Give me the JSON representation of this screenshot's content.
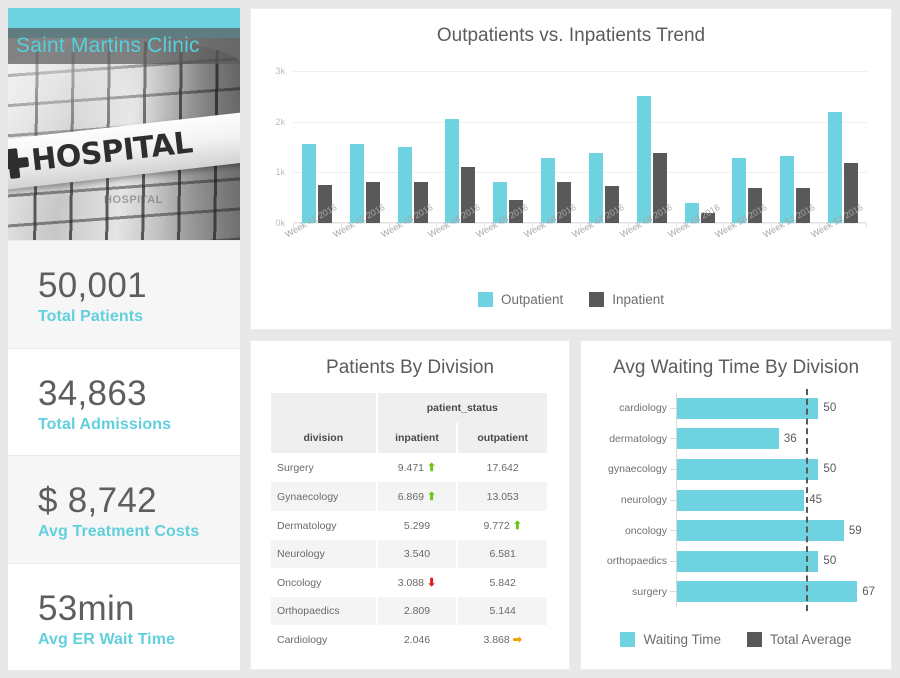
{
  "theme": {
    "accent": "#6ed2e0",
    "dark_bar": "#59595a",
    "value_text": "#5e5e5e"
  },
  "sidebar": {
    "brand": {
      "title": "Saint Martins Clinic",
      "photo_sign_word": "HOSPITAL",
      "photo_ghost_word": "HOSPITAL",
      "cross_icon": "medical-cross-icon"
    },
    "kpis": [
      {
        "value": "50,001",
        "label": "Total Patients"
      },
      {
        "value": "34,863",
        "label": "Total Admissions"
      },
      {
        "value": "$ 8,742",
        "label": "Avg Treatment Costs"
      },
      {
        "value": "53min",
        "label": "Avg ER Wait Time"
      }
    ]
  },
  "trend_card": {
    "title": "Outpatients vs. Inpatients Trend"
  },
  "table_card": {
    "title": "Patients By Division",
    "group_header": "patient_status",
    "columns": [
      "division",
      "inpatient",
      "outpatient"
    ],
    "rows": [
      {
        "division": "Surgery",
        "inpatient": "9.471",
        "inpatient_trend": "up",
        "outpatient": "17.642",
        "outpatient_trend": ""
      },
      {
        "division": "Gynaecology",
        "inpatient": "6.869",
        "inpatient_trend": "up",
        "outpatient": "13.053",
        "outpatient_trend": ""
      },
      {
        "division": "Dermatology",
        "inpatient": "5.299",
        "inpatient_trend": "",
        "outpatient": "9.772",
        "outpatient_trend": "up"
      },
      {
        "division": "Neurology",
        "inpatient": "3.540",
        "inpatient_trend": "",
        "outpatient": "6.581",
        "outpatient_trend": ""
      },
      {
        "division": "Oncology",
        "inpatient": "3.088",
        "inpatient_trend": "down",
        "outpatient": "5.842",
        "outpatient_trend": ""
      },
      {
        "division": "Orthopaedics",
        "inpatient": "2.809",
        "inpatient_trend": "",
        "outpatient": "5.144",
        "outpatient_trend": ""
      },
      {
        "division": "Cardiology",
        "inpatient": "2.046",
        "inpatient_trend": "",
        "outpatient": "3.868",
        "outpatient_trend": "flat"
      }
    ]
  },
  "wait_card": {
    "title": "Avg Waiting Time By Division"
  },
  "chart_data": [
    {
      "type": "bar",
      "title": "Outpatients vs. Inpatients Trend",
      "xlabel": "",
      "ylabel": "",
      "ylim": [
        0,
        3000
      ],
      "yticks": [
        0,
        1000,
        2000,
        3000
      ],
      "ytick_labels": [
        "0k",
        "1k",
        "2k",
        "3k"
      ],
      "grid": true,
      "legend_position": "bottom",
      "categories": [
        "Week 41 2016",
        "Week 42 2016",
        "Week 43 2016",
        "Week 44 2016",
        "Week 45 2016",
        "Week 46 2016",
        "Week 47 2016",
        "Week 48 2016",
        "Week 49 2016",
        "Week 50 2016",
        "Week 51 2016",
        "Week 52 2016"
      ],
      "series": [
        {
          "name": "Outpatient",
          "color": "#6ed2e0",
          "values": [
            1560,
            1550,
            1510,
            2060,
            800,
            1290,
            1380,
            2500,
            400,
            1290,
            1320,
            2200
          ]
        },
        {
          "name": "Inpatient",
          "color": "#59595a",
          "values": [
            750,
            800,
            810,
            1100,
            460,
            800,
            740,
            1380,
            200,
            700,
            700,
            1180
          ]
        }
      ]
    },
    {
      "type": "bar",
      "orientation": "horizontal",
      "title": "Avg Waiting Time By Division",
      "xlabel": "",
      "ylabel": "",
      "xlim": [
        0,
        70
      ],
      "grid": false,
      "legend_position": "bottom",
      "categories": [
        "cardiology",
        "dermatology",
        "gynaecology",
        "neurology",
        "oncology",
        "orthopaedics",
        "surgery"
      ],
      "values": [
        50,
        36,
        50,
        45,
        59,
        50,
        67
      ],
      "data_labels": [
        "50",
        "36",
        "50",
        "45",
        "59",
        "50",
        "67"
      ],
      "reference_line": {
        "name": "Total Average",
        "value": 45.5,
        "style": "dashed",
        "color": "#595959"
      },
      "series": [
        {
          "name": "Waiting Time",
          "color": "#6ed2e0",
          "values": [
            50,
            36,
            50,
            45,
            59,
            50,
            67
          ]
        }
      ],
      "legend": [
        "Waiting Time",
        "Total Average"
      ]
    }
  ]
}
